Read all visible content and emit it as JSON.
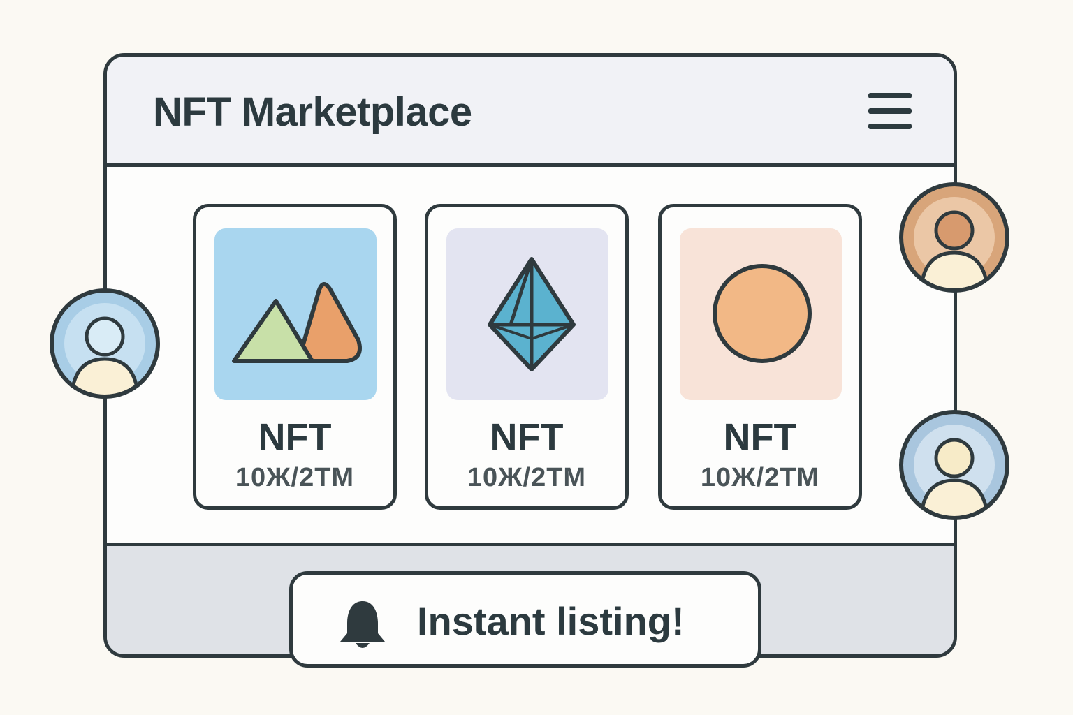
{
  "header": {
    "title": "NFT Marketplace",
    "menu_icon": "hamburger-menu-icon"
  },
  "cards": [
    {
      "name": "NFT",
      "price": "10Ж/2TM",
      "artwork": "mountains-icon",
      "thumb_color": "#a9d6ef"
    },
    {
      "name": "NFT",
      "price": "10Ж/2TM",
      "artwork": "ethereum-crystal-icon",
      "thumb_color": "#e3e4f1"
    },
    {
      "name": "NFT",
      "price": "10Ж/2TM",
      "artwork": "orange-circle-icon",
      "thumb_color": "#f8e3d8"
    }
  ],
  "notification": {
    "icon": "bell-icon",
    "text": "Instant listing!"
  },
  "avatars": [
    {
      "name": "user-avatar-left",
      "color": "#a8cde6"
    },
    {
      "name": "user-avatar-top-right",
      "color": "#d8a57a"
    },
    {
      "name": "user-avatar-bottom-right",
      "color": "#a9c6de"
    }
  ],
  "colors": {
    "outline": "#2f3a3e",
    "background": "#fbf9f3",
    "header_bg": "#f1f2f6",
    "footer_bg": "#dfe2e7"
  }
}
